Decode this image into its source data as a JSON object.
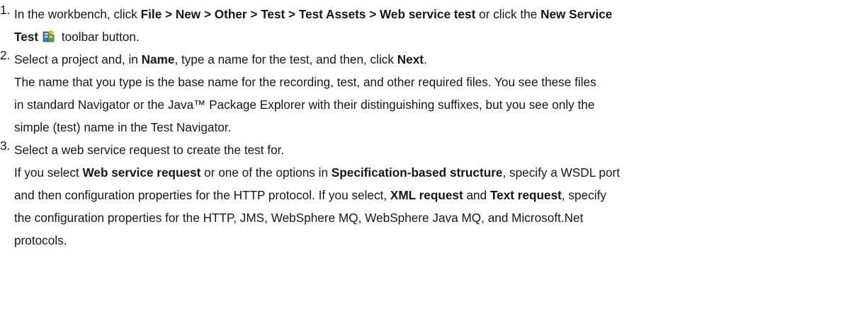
{
  "steps": [
    {
      "number": "1.",
      "a_pre": "In the workbench, click ",
      "a_path": "File > New > Other > Test > Test Assets > Web service test",
      "a_mid": " or click the ",
      "a_btn1": "New Service",
      "b_btn2": "Test",
      "b_post": " toolbar button.",
      "icon": "new-service-test-icon"
    },
    {
      "number": "2.",
      "a_pre": "Select a project and, in ",
      "a_name": "Name",
      "a_mid": ", type a name for the test, and then, click ",
      "a_next": "Next",
      "a_post": ".",
      "p1": "The name that you type is the base name for the recording, test, and other required files. You see these files",
      "p2": "in standard Navigator or the Java™ Package Explorer with their distinguishing suffixes, but you see only the",
      "p3": "simple (test) name in the Test Navigator."
    },
    {
      "number": "3.",
      "a_text": "Select a web service request to create the test for.",
      "b_pre": "If you select ",
      "b_wsr": "Web service request",
      "b_mid": " or one of the options in ",
      "b_spec": "Specification-based structure",
      "b_post": ", specify a WSDL port",
      "c_pre": "and then configuration properties for the HTTP protocol. If you select, ",
      "c_xml": "XML request",
      "c_and": " and ",
      "c_text": "Text request",
      "c_post": ", specify",
      "d_text": "the configuration properties for the HTTP, JMS, WebSphere MQ, WebSphere Java MQ, and Microsoft.Net",
      "e_text": "protocols."
    }
  ]
}
